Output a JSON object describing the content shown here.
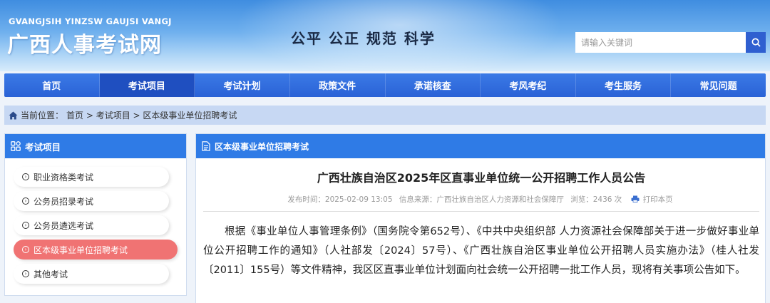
{
  "header": {
    "logo_pinyin": "GVANGJSIH YINZSW GAUJSI VANGJ",
    "logo_cn": "广西人事考试网",
    "slogan": "公平 公正 规范 科学",
    "search_placeholder": "请输入关键词",
    "search_icon": "search-icon"
  },
  "nav": {
    "items": [
      {
        "label": "首页"
      },
      {
        "label": "考试项目"
      },
      {
        "label": "考试计划"
      },
      {
        "label": "政策文件"
      },
      {
        "label": "承诺核查"
      },
      {
        "label": "考风考纪"
      },
      {
        "label": "考生服务"
      },
      {
        "label": "常见问题"
      }
    ],
    "active_index": 1
  },
  "breadcrumb": {
    "prefix": "当前位置：",
    "path": "首页 > 考试项目 > 区本级事业单位招聘考试"
  },
  "sidebar": {
    "title": "考试项目",
    "items": [
      {
        "label": "职业资格类考试"
      },
      {
        "label": "公务员招录考试"
      },
      {
        "label": "公务员遴选考试"
      },
      {
        "label": "区本级事业单位招聘考试"
      },
      {
        "label": "其他考试"
      }
    ],
    "active_index": 3
  },
  "content": {
    "section_title": "区本级事业单位招聘考试",
    "article_title": "广西壮族自治区2025年区直事业单位统一公开招聘工作人员公告",
    "meta": {
      "published": "发布时间：2025-02-09 13:05",
      "source": "信息来源：广西壮族自治区人力资源和社会保障厅",
      "views": "浏览：2436 次",
      "print": "打印本页"
    },
    "body": "根据《事业单位人事管理条例》（国务院令第652号）、《中共中央组织部 人力资源社会保障部关于进一步做好事业单位公开招聘工作的通知》（人社部发〔2024〕57号）、《广西壮族自治区事业单位公开招聘人员实施办法》（桂人社发〔2011〕155号）等文件精神，我区区直事业单位计划面向社会统一公开招聘一批工作人员，现将有关事项公告如下。"
  },
  "colors": {
    "nav_bg": "#2a62d6",
    "panel_head": "#2f7be6",
    "active_item": "#f07373",
    "crumb_bg": "#c7d8f3"
  }
}
